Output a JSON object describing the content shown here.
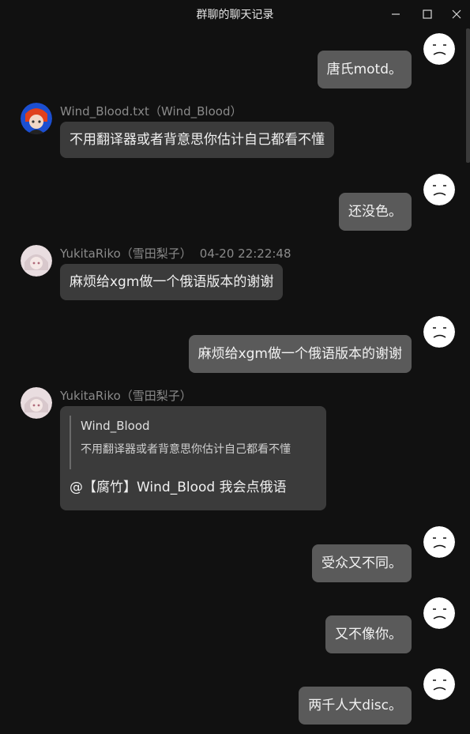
{
  "window": {
    "title": "群聊的聊天记录",
    "minimize_icon": "minimize-icon",
    "maximize_icon": "maximize-icon",
    "close_icon": "close-icon"
  },
  "messages": [
    {
      "direction": "out",
      "text": "唐氏motd。"
    },
    {
      "direction": "in",
      "sender": "Wind_Blood.txt（Wind_Blood）",
      "text": "不用翻译器或者背意思你估计自己都看不懂"
    },
    {
      "direction": "out",
      "text": "还没色。"
    },
    {
      "direction": "in",
      "sender": "YukitaRiko（雪田梨子）",
      "time": "04-20 22:22:48",
      "text": "麻烦给xgm做一个俄语版本的谢谢"
    },
    {
      "direction": "out",
      "text": "麻烦给xgm做一个俄语版本的谢谢"
    },
    {
      "direction": "in",
      "sender": "YukitaRiko（雪田梨子）",
      "quote_author": "Wind_Blood",
      "quote_text": "不用翻译器或者背意思你估计自己都看不懂",
      "text": "@【腐竹】Wind_Blood 我会点俄语"
    },
    {
      "direction": "out",
      "text": "受众又不同。"
    },
    {
      "direction": "out",
      "text": "又不像你。"
    },
    {
      "direction": "out",
      "text": "两千人大disc。"
    }
  ],
  "colors": {
    "background": "#111111",
    "bubble_out": "#5a5a5a",
    "bubble_in": "#3b3b3b",
    "sender_text": "#8a8a8a"
  }
}
